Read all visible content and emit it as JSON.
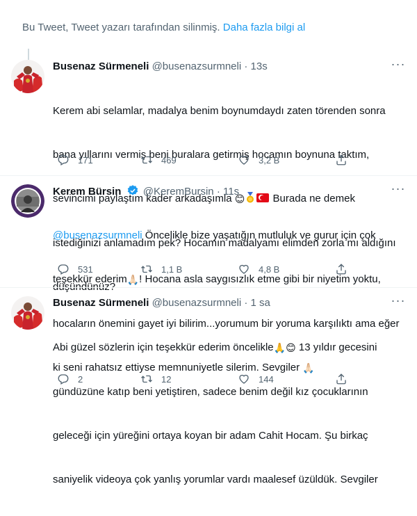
{
  "banner": {
    "text": "Bu Tweet, Tweet yazarı tarafından silinmiş.",
    "link": "Daha fazla bilgi al"
  },
  "tweets": [
    {
      "name": "Busenaz Sürmeneli",
      "handle": "@busenazsurmneli",
      "dot": "·",
      "time": "13s",
      "lines": [
        "Kerem abi selamlar, madalya benim boynumdaydı zaten törenden sonra",
        "bana yıllarını vermiş beni buralara getirmiş hocamın boynuna taktım,",
        "sevincimi paylaştım kader arkadaşımla",
        "Burada ne demek",
        "istediğinizi anlamadım pek? Hocamın madalyamı elimden zorla mı aldığını",
        "düşündünüz?"
      ],
      "emoji_smile": "😊",
      "reply_count": "171",
      "retweet_count": "469",
      "like_count": "3,2 B"
    },
    {
      "name": "Kerem Bürsin",
      "handle": "@KeremBursin",
      "dot": "·",
      "time": "11s",
      "mention": "@busenazsurmneli",
      "lines": [
        " Öncelikle bize yaşatığın mutluluk ve gurur için çok",
        "teşekkür ederim",
        "! Hocana asla saygısızlık etme gibi bir niyetim yoktu,",
        "hocaların önemini gayet iyi bilirim...yorumum bir yoruma karşılıktı ama eğer",
        "ki seni rahatsız ettiyse memnuniyetle silerim. Sevgiler"
      ],
      "emoji_pray": "🙏🏻",
      "reply_count": "531",
      "retweet_count": "1,1 B",
      "like_count": "4,8 B"
    },
    {
      "name": "Busenaz Sürmeneli",
      "handle": "@busenazsurmneli",
      "dot": "·",
      "time": "1 sa",
      "lines": [
        "Abi güzel sözlerin için teşekkür ederim öncelikle",
        " 13 yıldır gecesini",
        "gündüzüne katıp beni yetiştiren, sadece benim değil kız çocuklarının",
        "geleceği için yüreğini ortaya koyan bir adam Cahit Hocam. Şu birkaç",
        "saniyelik videoya çok yanlış yorumlar vardı maalesef üzüldük. Sevgiler"
      ],
      "emoji_pray": "🙏",
      "emoji_smile": "😊",
      "reply_count": "2",
      "retweet_count": "12",
      "like_count": "144"
    }
  ],
  "icons": {
    "reply": "reply-icon",
    "retweet": "retweet-icon",
    "like": "like-icon",
    "share": "share-icon",
    "more": "more-icon",
    "verified": "verified-badge-icon"
  },
  "colors": {
    "link": "#1d9bf0",
    "secondary": "#536471",
    "verified": "#1d9bf0",
    "divider": "#eff3f4"
  }
}
